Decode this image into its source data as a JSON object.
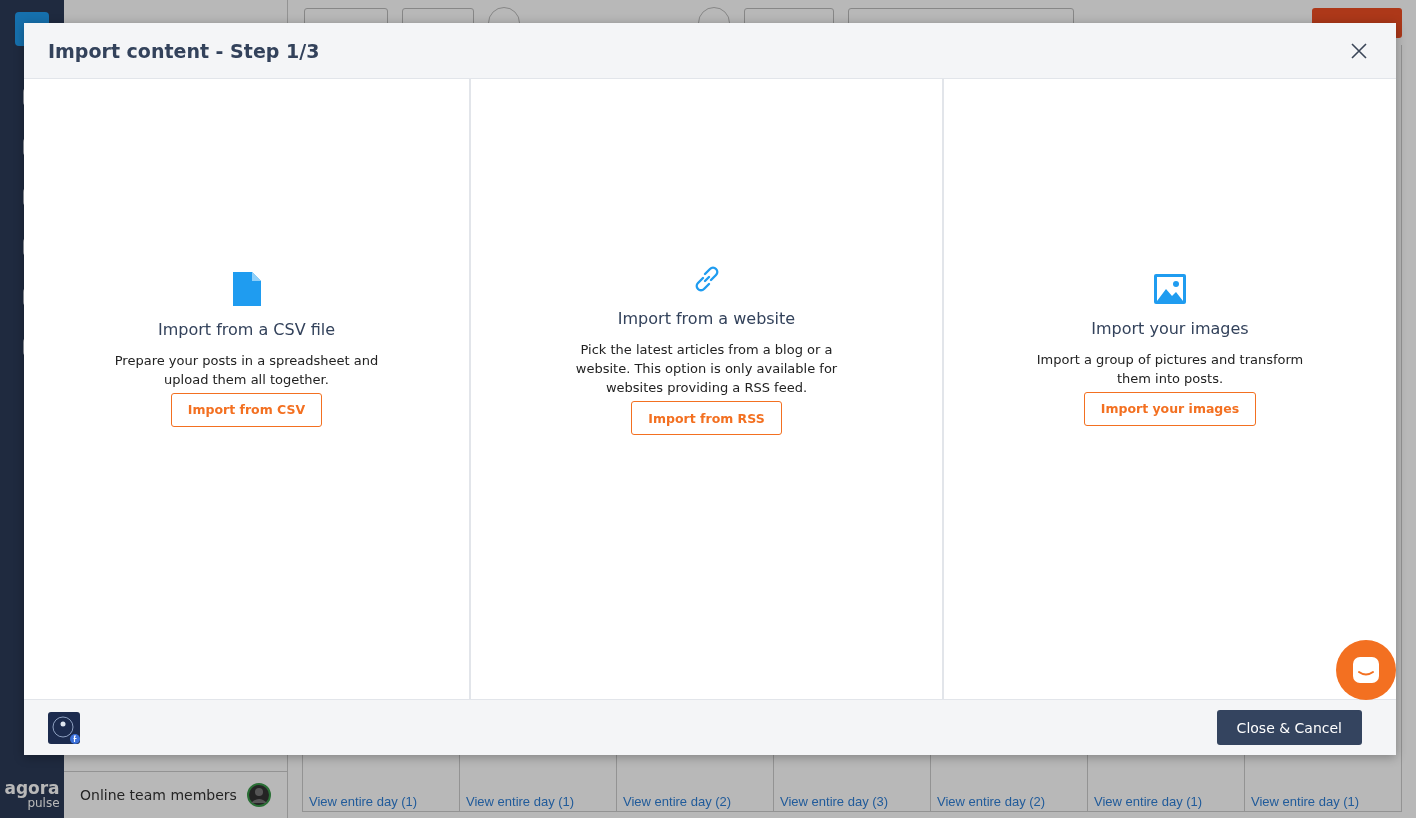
{
  "sidebar": {
    "logo": {
      "word": "agora",
      "sub": "pulse"
    }
  },
  "profiles_panel": {
    "footer": "Online team members"
  },
  "calendar": {
    "day_links": [
      "View entire day (1)",
      "View entire day (1)",
      "View entire day (2)",
      "View entire day (3)",
      "View entire day (2)",
      "View entire day (1)",
      "View entire day (1)"
    ]
  },
  "modal": {
    "title": "Import content - Step 1/3",
    "options": [
      {
        "kind": "csv",
        "title": "Import from a CSV file",
        "description": "Prepare your posts in a spreadsheet and upload them all together.",
        "button": "Import from CSV"
      },
      {
        "kind": "website",
        "title": "Import from a website",
        "description": "Pick the latest articles from a blog or a website. This option is only available for websites providing a RSS feed.",
        "button": "Import from RSS"
      },
      {
        "kind": "images",
        "title": "Import your images",
        "description": "Import a group of pictures and transform them into posts.",
        "button": "Import your images"
      }
    ],
    "close_button": "Close & Cancel"
  }
}
